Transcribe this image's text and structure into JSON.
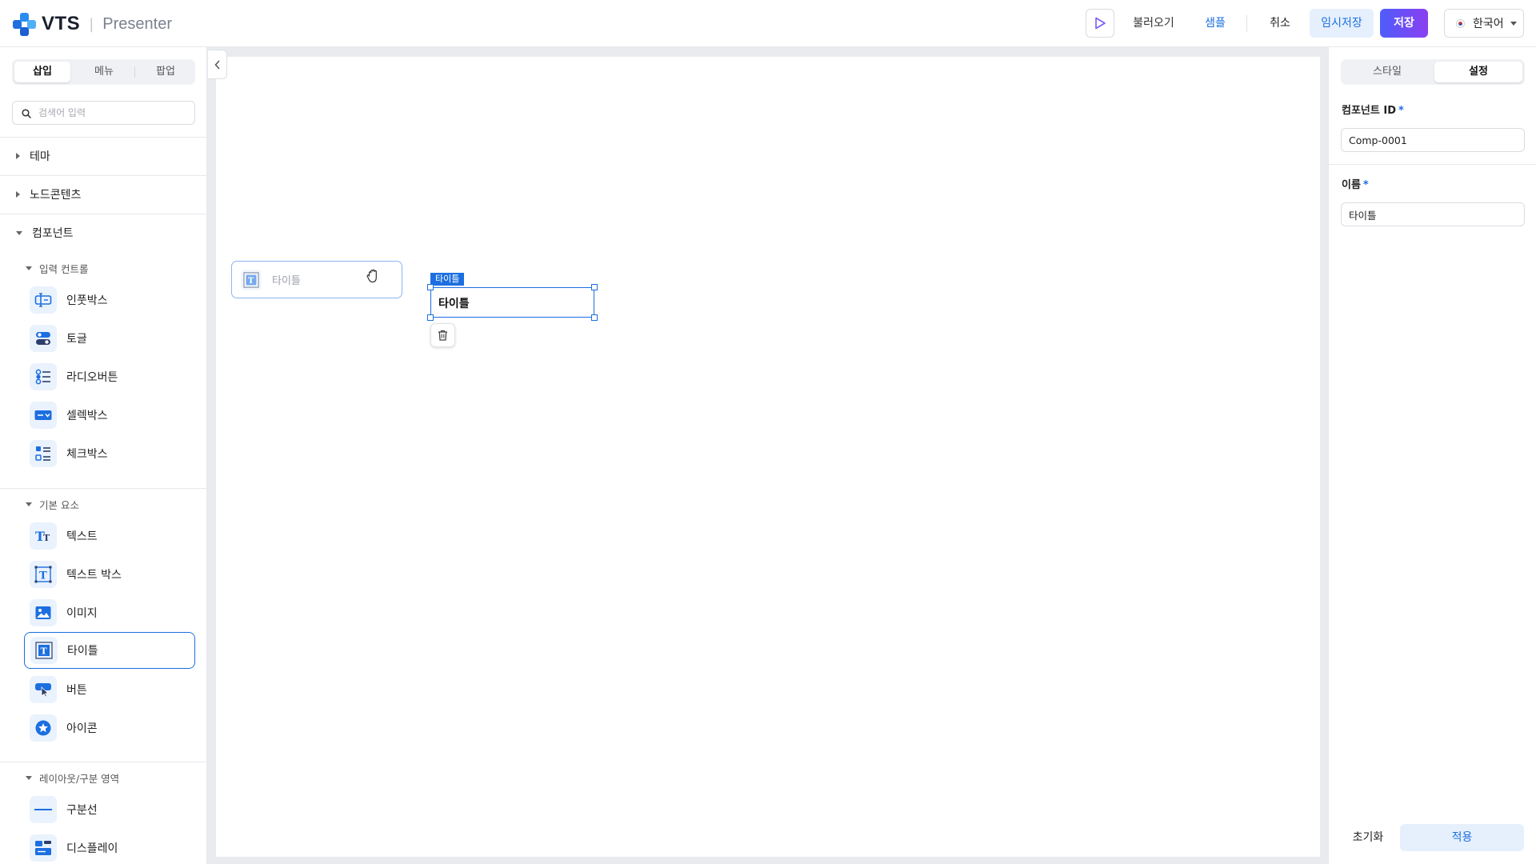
{
  "header": {
    "brand": "VTS",
    "product": "Presenter",
    "load_label": "불러오기",
    "sample_label": "샘플",
    "cancel_label": "취소",
    "temp_save_label": "임시저장",
    "save_label": "저장",
    "language": "한국어"
  },
  "left_panel": {
    "tabs": [
      "삽입",
      "메뉴",
      "팝업"
    ],
    "search_placeholder": "검색어 입력",
    "sections": {
      "theme": "테마",
      "node_contents": "노드콘텐츠",
      "components": "컴포넌트"
    },
    "input_controls": {
      "title": "입력 컨트롤",
      "items": [
        "인풋박스",
        "토글",
        "라디오버튼",
        "셀렉박스",
        "체크박스"
      ]
    },
    "basic_elements": {
      "title": "기본 요소",
      "items": [
        "텍스트",
        "텍스트 박스",
        "이미지",
        "타이틀",
        "버튼",
        "아이콘"
      ]
    },
    "layout": {
      "title": "레이아웃/구분 영역",
      "items": [
        "구분선",
        "디스플레이"
      ]
    }
  },
  "canvas": {
    "drag_ghost_label": "타이틀",
    "selected_tag": "타이틀",
    "selected_text": "타이틀"
  },
  "right_panel": {
    "tabs": [
      "스타일",
      "설정"
    ],
    "component_id_label": "컴포넌트 ID",
    "component_id_value": "Comp-0001",
    "name_label": "이름",
    "name_value": "타이틀",
    "required_mark": "*",
    "reset_label": "초기화",
    "apply_label": "적용"
  },
  "colors": {
    "accent": "#1c6fe0",
    "save_gradient_start": "#4e5dfb",
    "save_gradient_end": "#8a3ff0",
    "canvas_bg": "#e9ebee"
  }
}
